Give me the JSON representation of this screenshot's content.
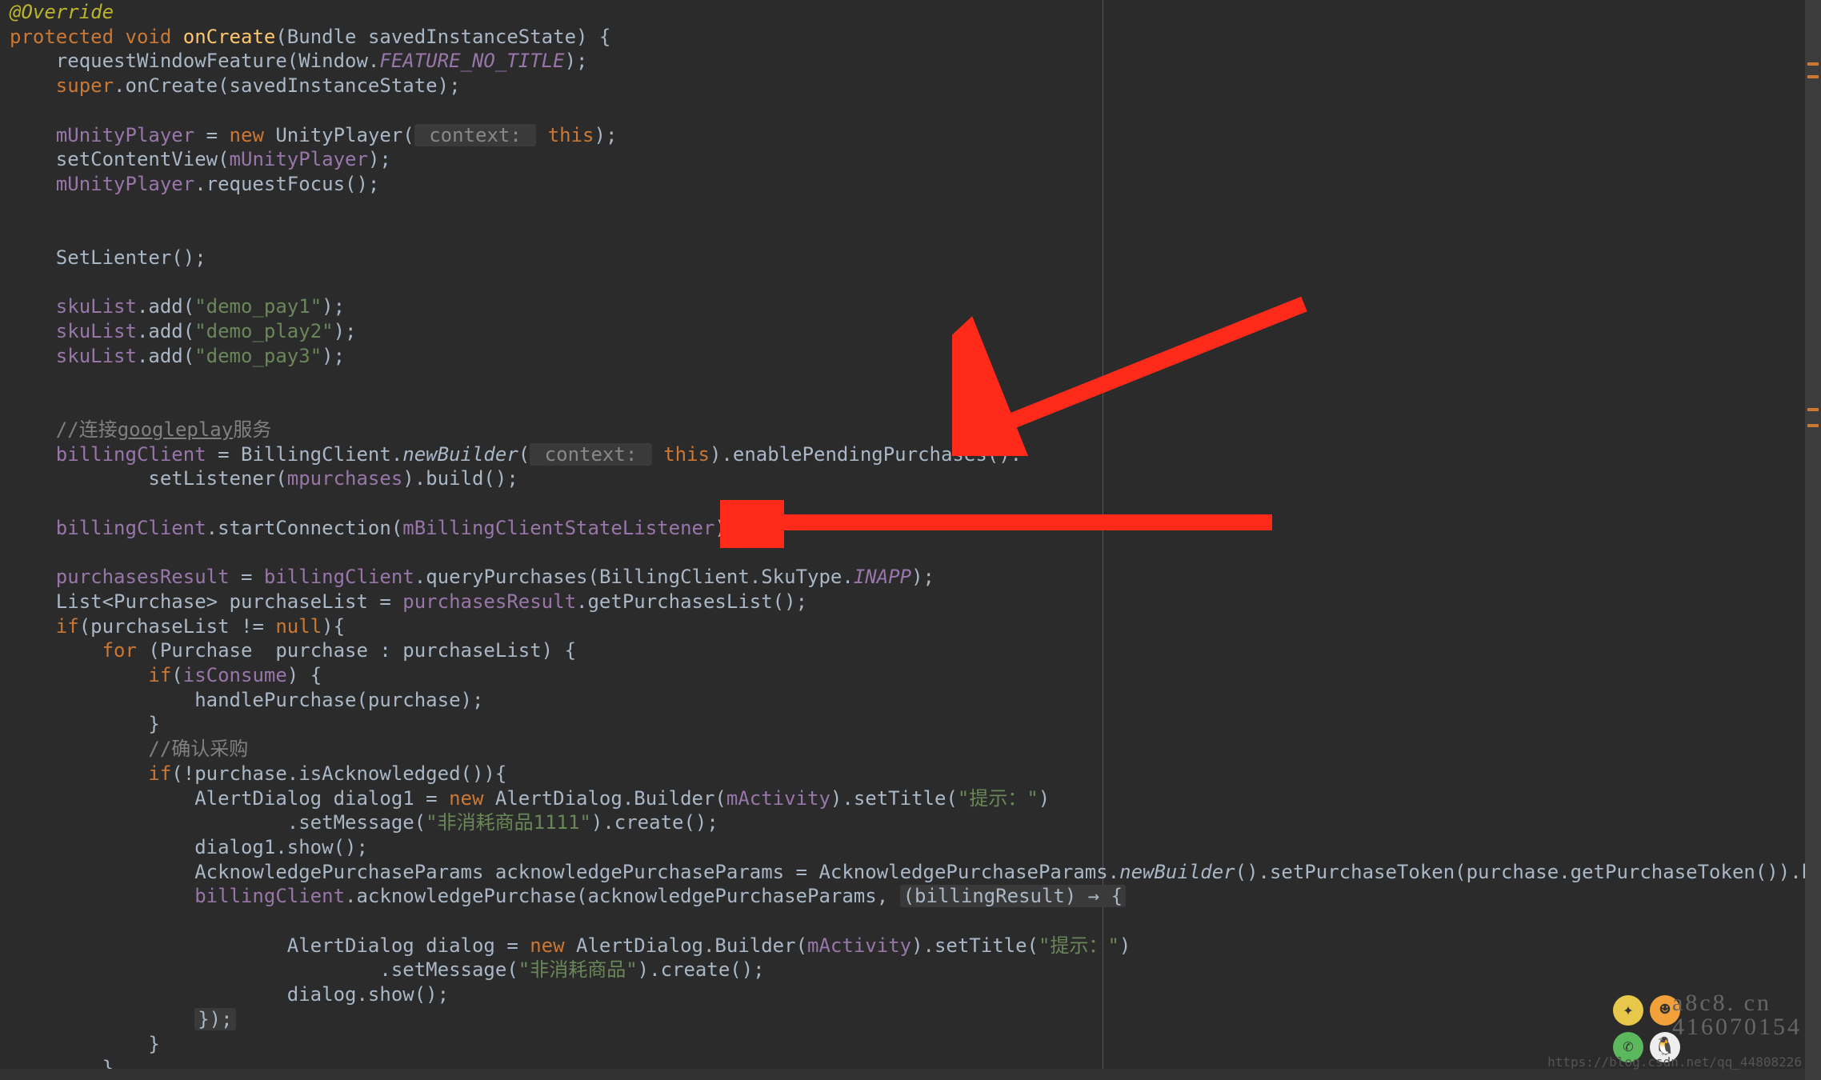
{
  "code": {
    "l1": "@Override",
    "l2a": "protected",
    "l2b": "void",
    "l2c": "onCreate",
    "l2d": "(Bundle savedInstanceState) {",
    "l3a": "    requestWindowFeature(Window.",
    "l3b": "FEATURE_NO_TITLE",
    "l3c": ");",
    "l4a": "    ",
    "l4b": "super",
    "l4c": ".onCreate(savedInstanceState);",
    "l5": "",
    "l6a": "    ",
    "l6b": "mUnityPlayer",
    "l6c": " = ",
    "l6d": "new",
    "l6e": " UnityPlayer(",
    "l6f": " context: ",
    "l6g": "this",
    "l6h": ");",
    "l7a": "    setContentView(",
    "l7b": "mUnityPlayer",
    "l7c": ");",
    "l8a": "    ",
    "l8b": "mUnityPlayer",
    "l8c": ".requestFocus();",
    "l9": "",
    "l10": "",
    "l11": "    SetLienter();",
    "l12": "",
    "l13a": "    ",
    "l13b": "skuList",
    "l13c": ".add(",
    "l13d": "\"demo_pay1\"",
    "l13e": ");",
    "l14a": "    ",
    "l14b": "skuList",
    "l14c": ".add(",
    "l14d": "\"demo_play2\"",
    "l14e": ");",
    "l15a": "    ",
    "l15b": "skuList",
    "l15c": ".add(",
    "l15d": "\"demo_pay3\"",
    "l15e": ");",
    "l16": "",
    "l17": "",
    "l18a": "    ",
    "l18b": "//连接",
    "l18c": "googleplay",
    "l18d": "服务",
    "l19a": "    ",
    "l19b": "billingClient",
    "l19c": " = BillingClient.",
    "l19d": "newBuilder",
    "l19e": "(",
    "l19f": " context: ",
    "l19g": "this",
    "l19h": ").enablePendingPurchases().",
    "l20a": "            setListener(",
    "l20b": "mpurchases",
    "l20c": ").build();",
    "l21": "",
    "l22a": "    ",
    "l22b": "billingClient",
    "l22c": ".startConnection(",
    "l22d": "mBillingClientStateListener",
    "l22e": ");",
    "l23": "",
    "l24a": "    ",
    "l24b": "purchasesResult",
    "l24c": " = ",
    "l24d": "billingClient",
    "l24e": ".queryPurchases(BillingClient.SkuType.",
    "l24f": "INAPP",
    "l24g": ");",
    "l25a": "    List<Purchase> purchaseList = ",
    "l25b": "purchasesResult",
    "l25c": ".getPurchasesList();",
    "l26a": "    ",
    "l26b": "if",
    "l26c": "(purchaseList != ",
    "l26d": "null",
    "l26e": "){",
    "l27a": "        ",
    "l27b": "for",
    "l27c": " (Purchase  purchase : purchaseList) {",
    "l28a": "            ",
    "l28b": "if",
    "l28c": "(",
    "l28d": "isConsume",
    "l28e": ") {",
    "l29": "                handlePurchase(purchase);",
    "l30": "            }",
    "l31a": "            ",
    "l31b": "//确认采购",
    "l32a": "            ",
    "l32b": "if",
    "l32c": "(!purchase.isAcknowledged()){",
    "l33a": "                AlertDialog dialog1 = ",
    "l33b": "new",
    "l33c": " AlertDialog.Builder(",
    "l33d": "mActivity",
    "l33e": ").setTitle(",
    "l33f": "\"提示：\"",
    "l33g": ")",
    "l34a": "                        .setMessage(",
    "l34b": "\"非消耗商品1111\"",
    "l34c": ").create();",
    "l35": "                dialog1.show();",
    "l36a": "                AcknowledgePurchaseParams acknowledgePurchaseParams = AcknowledgePurchaseParams.",
    "l36b": "newBuilder",
    "l36c": "().setPurchaseToken(purchase.getPurchaseToken()).build(",
    "l37a": "                ",
    "l37b": "billingClient",
    "l37c": ".acknowledgePurchase(acknowledgePurchaseParams, ",
    "l37d": "(billingResult) → {",
    "l38": "",
    "l39a": "                        AlertDialog dialog = ",
    "l39b": "new",
    "l39c": " AlertDialog.Builder(",
    "l39d": "mActivity",
    "l39e": ").setTitle(",
    "l39f": "\"提示：\"",
    "l39g": ")",
    "l40a": "                                .setMessage(",
    "l40b": "\"非消耗商品\"",
    "l40c": ").create();",
    "l41": "                        dialog.show();",
    "l42a": "                ",
    "l42b": "});",
    "l43": "            }",
    "l44": "        }"
  },
  "watermark": {
    "line1": "a8c8. cn",
    "line2": "416070154",
    "credit": "https://blog.csdn.net/qq_44808226"
  },
  "scroll_markers": [
    78,
    94,
    510,
    530
  ]
}
